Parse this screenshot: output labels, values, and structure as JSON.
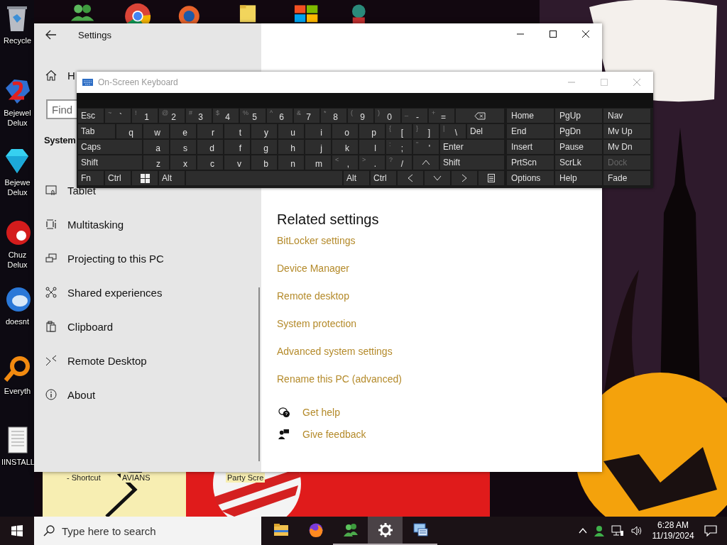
{
  "desktop_icons": [
    {
      "label": "Recycle"
    },
    {
      "label": "Bejewel Delux"
    },
    {
      "label": "Bejewe Delux"
    },
    {
      "label": "Chuz Delux"
    },
    {
      "label": "doesnt"
    },
    {
      "label": "Everyth"
    },
    {
      "label": "IINSTALL"
    }
  ],
  "desktop_labels": [
    {
      "label": "- Shortcut"
    },
    {
      "label": "AVIANS"
    },
    {
      "label": "Party Scre"
    }
  ],
  "settings": {
    "title": "Settings",
    "home": "H",
    "search": {
      "placeholder": "Find"
    },
    "section": "System",
    "nav": [
      {
        "label": "Tablet"
      },
      {
        "label": "Multitasking"
      },
      {
        "label": "Projecting to this PC"
      },
      {
        "label": "Shared experiences"
      },
      {
        "label": "Clipboard"
      },
      {
        "label": "Remote Desktop"
      },
      {
        "label": "About"
      }
    ],
    "related_heading": "Related settings",
    "related_links": [
      "BitLocker settings",
      "Device Manager",
      "Remote desktop",
      "System protection",
      "Advanced system settings",
      "Rename this PC (advanced)"
    ],
    "help_links": [
      "Get help",
      "Give feedback"
    ]
  },
  "keyboard": {
    "title": "On-Screen Keyboard",
    "rows": [
      {
        "keys": [
          {
            "kind": "fn",
            "label": "Esc"
          },
          {
            "kind": "char",
            "shift": "~",
            "label": "`"
          },
          {
            "kind": "char",
            "shift": "!",
            "label": "1"
          },
          {
            "kind": "char",
            "shift": "@",
            "label": "2"
          },
          {
            "kind": "char",
            "shift": "#",
            "label": "3"
          },
          {
            "kind": "char",
            "shift": "$",
            "label": "4"
          },
          {
            "kind": "char",
            "shift": "%",
            "label": "5"
          },
          {
            "kind": "char",
            "shift": "^",
            "label": "6"
          },
          {
            "kind": "char",
            "shift": "&",
            "label": "7"
          },
          {
            "kind": "char",
            "shift": "*",
            "label": "8"
          },
          {
            "kind": "char",
            "shift": "(",
            "label": "9"
          },
          {
            "kind": "char",
            "shift": ")",
            "label": "0"
          },
          {
            "kind": "char",
            "shift": "_",
            "label": "-"
          },
          {
            "kind": "char",
            "shift": "+",
            "label": "="
          },
          {
            "kind": "backspace"
          }
        ]
      },
      {
        "keys": [
          {
            "kind": "fill",
            "label": "Tab"
          },
          {
            "kind": "char",
            "label": "q"
          },
          {
            "kind": "char",
            "label": "w"
          },
          {
            "kind": "char",
            "label": "e"
          },
          {
            "kind": "char",
            "label": "r"
          },
          {
            "kind": "char",
            "label": "t"
          },
          {
            "kind": "char",
            "label": "y"
          },
          {
            "kind": "char",
            "label": "u"
          },
          {
            "kind": "char",
            "label": "i"
          },
          {
            "kind": "char",
            "label": "o"
          },
          {
            "kind": "char",
            "label": "p"
          },
          {
            "kind": "char",
            "shift": "{",
            "label": "["
          },
          {
            "kind": "char",
            "shift": "}",
            "label": "]"
          },
          {
            "kind": "char",
            "shift": "|",
            "label": "\\"
          },
          {
            "kind": "fill",
            "label": "Del"
          }
        ]
      },
      {
        "keys": [
          {
            "kind": "fill",
            "label": "Caps"
          },
          {
            "kind": "char",
            "label": "a"
          },
          {
            "kind": "char",
            "label": "s"
          },
          {
            "kind": "char",
            "label": "d"
          },
          {
            "kind": "char",
            "label": "f"
          },
          {
            "kind": "char",
            "label": "g"
          },
          {
            "kind": "char",
            "label": "h"
          },
          {
            "kind": "char",
            "label": "j"
          },
          {
            "kind": "char",
            "label": "k"
          },
          {
            "kind": "char",
            "label": "l"
          },
          {
            "kind": "char",
            "shift": ":",
            "label": ";"
          },
          {
            "kind": "char",
            "shift": "\"",
            "label": "'"
          },
          {
            "kind": "fill",
            "label": "Enter"
          }
        ]
      },
      {
        "keys": [
          {
            "kind": "fill",
            "label": "Shift"
          },
          {
            "kind": "char",
            "label": "z"
          },
          {
            "kind": "char",
            "label": "x"
          },
          {
            "kind": "char",
            "label": "c"
          },
          {
            "kind": "char",
            "label": "v"
          },
          {
            "kind": "char",
            "label": "b"
          },
          {
            "kind": "char",
            "label": "n"
          },
          {
            "kind": "char",
            "label": "m"
          },
          {
            "kind": "char",
            "shift": "<",
            "label": ","
          },
          {
            "kind": "char",
            "shift": ">",
            "label": "."
          },
          {
            "kind": "char",
            "shift": "?",
            "label": "/"
          },
          {
            "kind": "up"
          },
          {
            "kind": "fill",
            "label": "Shift"
          }
        ]
      },
      {
        "keys": [
          {
            "kind": "fn",
            "label": "Fn"
          },
          {
            "kind": "fn",
            "label": "Ctrl"
          },
          {
            "kind": "windows"
          },
          {
            "kind": "fn",
            "label": "Alt"
          },
          {
            "kind": "space"
          },
          {
            "kind": "fn",
            "label": "Alt"
          },
          {
            "kind": "fn",
            "label": "Ctrl"
          },
          {
            "kind": "left"
          },
          {
            "kind": "down"
          },
          {
            "kind": "right"
          },
          {
            "kind": "menu"
          }
        ]
      }
    ],
    "nav_rows": [
      [
        {
          "label": "Home",
          "disabled": false
        },
        {
          "label": "PgUp",
          "disabled": false
        },
        {
          "label": "Nav",
          "disabled": false
        }
      ],
      [
        {
          "label": "End",
          "disabled": false
        },
        {
          "label": "PgDn",
          "disabled": false
        },
        {
          "label": "Mv Up",
          "disabled": false
        }
      ],
      [
        {
          "label": "Insert",
          "disabled": false
        },
        {
          "label": "Pause",
          "disabled": false
        },
        {
          "label": "Mv Dn",
          "disabled": false
        }
      ],
      [
        {
          "label": "PrtScn",
          "disabled": false
        },
        {
          "label": "ScrLk",
          "disabled": false
        },
        {
          "label": "Dock",
          "disabled": true
        }
      ],
      [
        {
          "label": "Options",
          "disabled": false
        },
        {
          "label": "Help",
          "disabled": false
        },
        {
          "label": "Fade",
          "disabled": false
        }
      ]
    ]
  },
  "taskbar": {
    "search": {
      "placeholder": "Type here to search"
    },
    "apps": [
      {
        "running": false,
        "selected": false
      },
      {
        "running": false,
        "selected": false
      },
      {
        "running": true,
        "selected": false
      },
      {
        "running": true,
        "selected": true
      },
      {
        "running": true,
        "selected": false
      }
    ],
    "clock": {
      "time": "6:28 AM",
      "date": "11/19/2024"
    }
  }
}
